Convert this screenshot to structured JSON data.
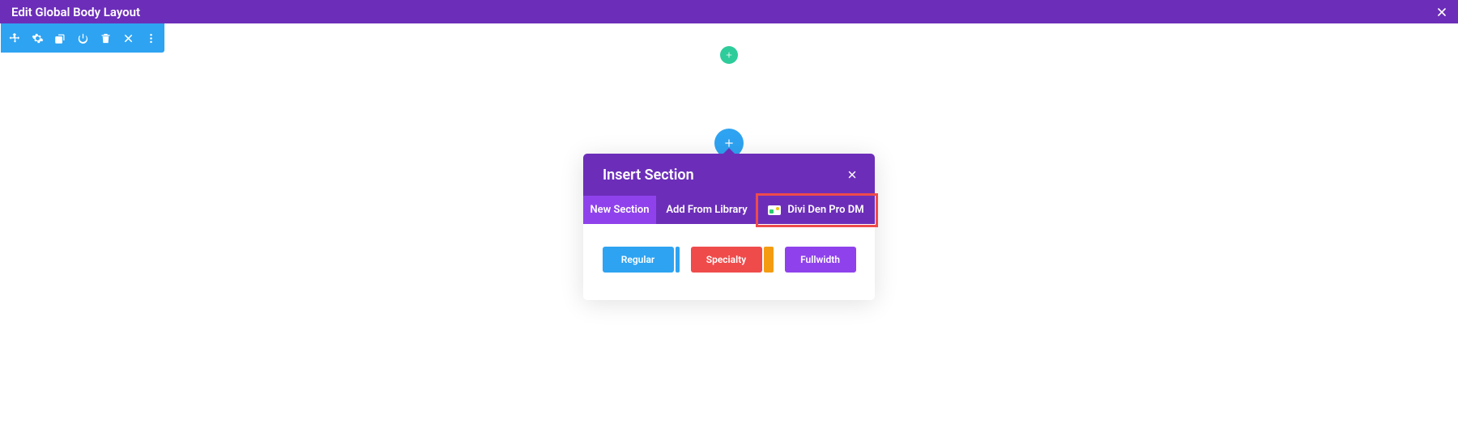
{
  "header": {
    "title": "Edit Global Body Layout"
  },
  "modal": {
    "title": "Insert Section",
    "tabs": [
      {
        "label": "New Section"
      },
      {
        "label": "Add From Library"
      },
      {
        "label": "Divi Den Pro DM"
      }
    ],
    "section_types": {
      "regular": "Regular",
      "specialty": "Specialty",
      "fullwidth": "Fullwidth"
    }
  }
}
